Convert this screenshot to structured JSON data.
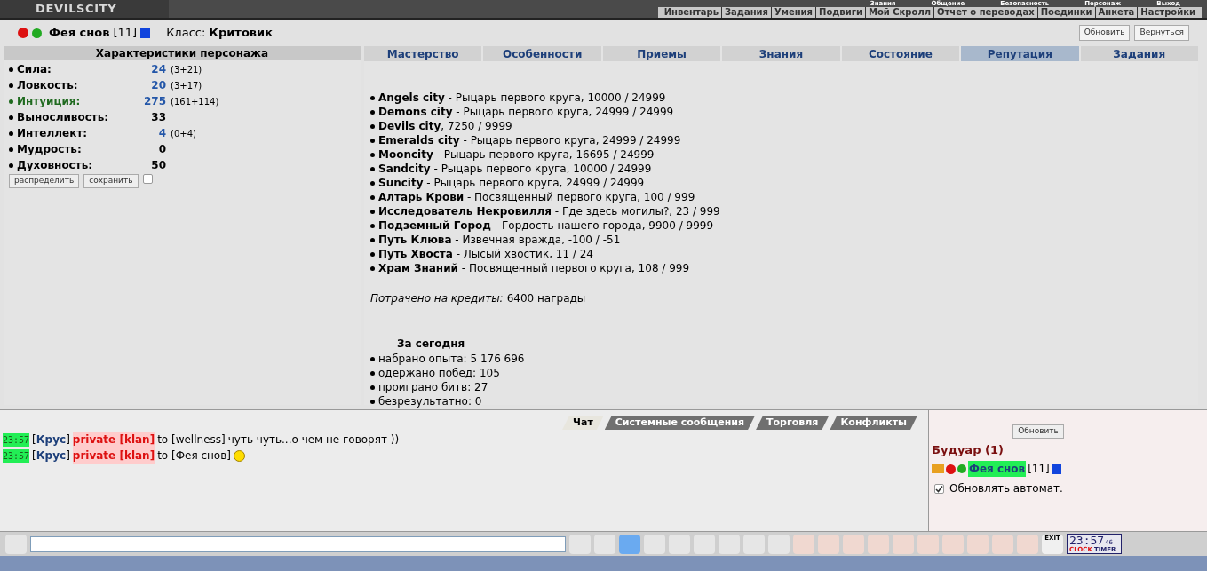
{
  "header": {
    "logo": "DEVILSCITY",
    "upper_menu": [
      "Знания",
      "Общение",
      "Безопасность",
      "Персонаж",
      "Выход"
    ],
    "menu": [
      "Инвентарь",
      "Задания",
      "Умения",
      "Подвиги",
      "Мой Скролл",
      "Отчет о переводах",
      "Поединки",
      "Анкета",
      "Настройки"
    ]
  },
  "character": {
    "name": "Фея снов",
    "level": "[11]",
    "class_label": "Класс:",
    "class": "Критовик"
  },
  "top_buttons": [
    "Обновить",
    "Вернуться"
  ],
  "stats_panel": {
    "title": "Характеристики персонажа",
    "stats": [
      {
        "label": "Сила:",
        "value": "24",
        "bonus": "(3+21)",
        "highlighted": false
      },
      {
        "label": "Ловкость:",
        "value": "20",
        "bonus": "(3+17)",
        "highlighted": false
      },
      {
        "label": "Интуиция:",
        "value": "275",
        "bonus": "(161+114)",
        "highlighted": true
      },
      {
        "label": "Выносливость:",
        "value": "33",
        "highlighted": false
      },
      {
        "label": "Интеллект:",
        "value": "4",
        "bonus": "(0+4)",
        "highlighted": false
      },
      {
        "label": "Мудрость:",
        "value": "0",
        "highlighted": false
      },
      {
        "label": "Духовность:",
        "value": "50",
        "highlighted": false
      }
    ],
    "buttons": [
      "распределить",
      "сохранить"
    ],
    "checked": false
  },
  "tabs": [
    {
      "label": "Мастерство",
      "selected": false
    },
    {
      "label": "Особенности",
      "selected": false
    },
    {
      "label": "Приемы",
      "selected": false
    },
    {
      "label": "Знания",
      "selected": false
    },
    {
      "label": "Состояние",
      "selected": false
    },
    {
      "label": "Репутация",
      "selected": true
    },
    {
      "label": "Задания",
      "selected": false
    }
  ],
  "reputation": [
    {
      "name": "Angels city",
      "detail": " - Рыцарь первого круга, 10000 / 24999"
    },
    {
      "name": "Demons city",
      "detail": " - Рыцарь первого круга, 24999 / 24999"
    },
    {
      "name": "Devils city",
      "detail": ", 7250 / 9999"
    },
    {
      "name": "Emeralds city",
      "detail": " - Рыцарь первого круга, 24999 / 24999"
    },
    {
      "name": "Mooncity",
      "detail": " - Рыцарь первого круга, 16695 / 24999"
    },
    {
      "name": "Sandcity",
      "detail": " - Рыцарь первого круга, 10000 / 24999"
    },
    {
      "name": "Suncity",
      "detail": " - Рыцарь первого круга, 24999 / 24999"
    },
    {
      "name": "Алтарь Крови",
      "detail": " - Посвященный первого круга, 100 / 999"
    },
    {
      "name": "Исследователь Некровилля",
      "detail": " - Где здесь могилы?, 23 / 999"
    },
    {
      "name": "Подземный Город",
      "detail": " - Гордость нашего города, 9900 / 9999"
    },
    {
      "name": "Путь Клюва",
      "detail": " - Извечная вражда, -100 / -51"
    },
    {
      "name": "Путь Хвоста",
      "detail": " - Лысый хвостик, 11 / 24"
    },
    {
      "name": "Храм Знаний",
      "detail": " - Посвященный первого круга, 108 / 999"
    }
  ],
  "credits": {
    "label": "Потрачено на кредиты:",
    "value": "6400 награды"
  },
  "today": {
    "title": "За сегодня",
    "items": [
      "набрано опыта: 5 176 696",
      "одержано побед: 105",
      "проиграно битв: 27",
      "безрезультатно: 0"
    ]
  },
  "chat_tabs": [
    {
      "label": "Чат",
      "selected": true
    },
    {
      "label": "Системные сообщения",
      "selected": false
    },
    {
      "label": "Торговля",
      "selected": false
    },
    {
      "label": "Конфликты",
      "selected": false
    }
  ],
  "chat": [
    {
      "time": "23:57",
      "sender": "[**Крус**]",
      "channel": "private [klan]",
      "to": "to [wellness]",
      "text": "чуть чуть...о чем не говорят ))",
      "smiley": false
    },
    {
      "time": "23:57",
      "sender": "[**Крус**]",
      "channel": "private [klan]",
      "to": "to [Фея снов]",
      "smiley": true
    }
  ],
  "room": {
    "button": "Обновить",
    "title": "Будуар (1)",
    "players": [
      {
        "name": "Фея снов",
        "level": "[11]"
      }
    ],
    "auto_label": "Обновлять автомат.",
    "auto_checked": true
  },
  "toolbar": {
    "filter_active": true,
    "exit_label": "EXIT",
    "clock": "23:57",
    "seconds": "46",
    "clock_label": "CLOCK",
    "timer_label": "TIMER"
  }
}
